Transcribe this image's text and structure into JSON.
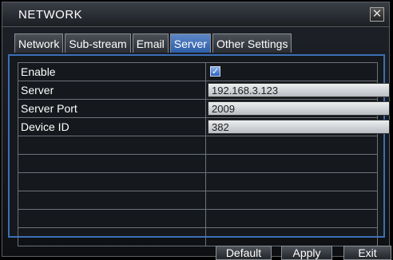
{
  "window": {
    "title": "NETWORK",
    "close_glyph": "✕"
  },
  "tabs": [
    {
      "label": "Network",
      "active": false
    },
    {
      "label": "Sub-stream",
      "active": false
    },
    {
      "label": "Email",
      "active": false
    },
    {
      "label": "Server",
      "active": true
    },
    {
      "label": "Other Settings",
      "active": false
    }
  ],
  "form": {
    "enable": {
      "label": "Enable",
      "checked": true,
      "check_glyph": "✓"
    },
    "server": {
      "label": "Server",
      "value": "192.168.3.123"
    },
    "server_port": {
      "label": "Server Port",
      "value": "2009"
    },
    "device_id": {
      "label": "Device ID",
      "value": "382"
    }
  },
  "buttons": {
    "default": "Default",
    "apply": "Apply",
    "exit": "Exit"
  },
  "colors": {
    "accent": "#3c6fb6",
    "active_tab": "#2d5ea8"
  }
}
